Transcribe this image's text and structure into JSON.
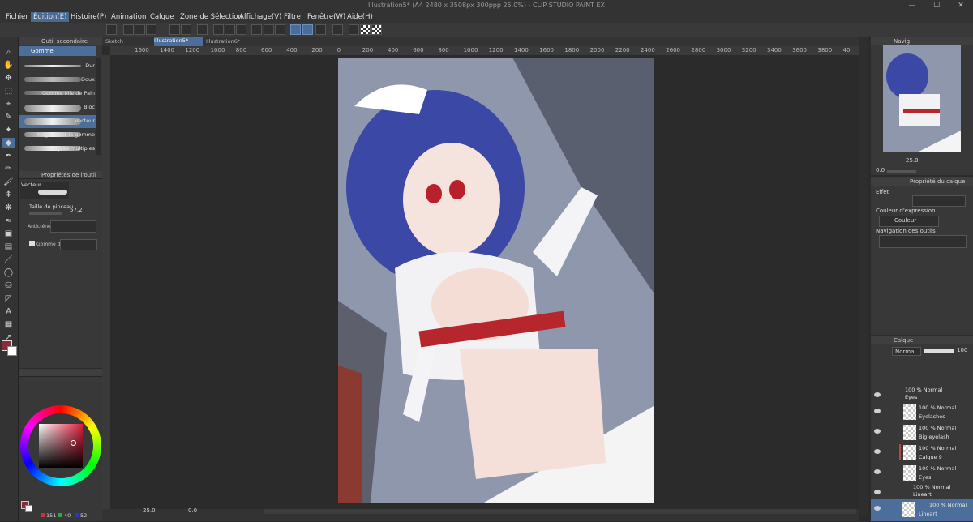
{
  "window": {
    "title": "Illustration5* (A4 2480 x 3508px 300ppp 25.0%) - CLIP STUDIO PAINT EX"
  },
  "menu": [
    "Fichier",
    "Édition(E)",
    "Histoire(P)",
    "Animation",
    "Calque",
    "Zone de Sélection",
    "Affichage(V)",
    "Filtre",
    "Fenêtre(W)",
    "Aide(H)"
  ],
  "tabs": [
    "Sketch",
    "Illustration5*",
    "Illustration6*"
  ],
  "ruler_top": [
    "1600",
    "1400",
    "1200",
    "1000",
    "800",
    "600",
    "400",
    "200",
    "0",
    "200",
    "400",
    "600",
    "800",
    "1000",
    "1200",
    "1400",
    "1600",
    "1800",
    "2000",
    "2200",
    "2400",
    "2600",
    "2800",
    "3000",
    "3200",
    "3400",
    "3600",
    "3800",
    "40"
  ],
  "subtool": {
    "title": "Outil secondaire",
    "group": "Gomme",
    "items": [
      "Dur",
      "Doux",
      "Gomme Mie de Pain",
      "Bloc",
      "Vecteur",
      "Magnétiser la gomme",
      "Calques multiples"
    ],
    "selected_index": 4
  },
  "tool_props": {
    "title": "Propriétés de l'outil",
    "name": "Vecteur",
    "brush_size_label": "Taille de pinceau",
    "brush_size_value": "57.2",
    "antialias_label": "Anticrénel.",
    "erase_label": "Gomme de"
  },
  "color_wheel": {
    "main_color": "#8b2b3a",
    "sub_color": "#ffffff",
    "r": "151",
    "g": "40",
    "b": "52"
  },
  "canvas_footer": {
    "zoom": "25.0",
    "rotation": "0.0"
  },
  "navigator": {
    "title": "Navig",
    "zoom": "25.0",
    "angle": "0.0"
  },
  "layer_props": {
    "title": "Propriété du calque",
    "effect_label": "Effet",
    "expression_color_label": "Couleur d'expression",
    "expression_color_value": "Couleur",
    "tool_nav_label": "Navigation des outils"
  },
  "layers_panel": {
    "title": "Calque",
    "blend_mode": "Normal",
    "opacity": "100",
    "layers": [
      {
        "mode": "100 % Normal",
        "name": "Eyes",
        "folder": true
      },
      {
        "mode": "100 % Normal",
        "name": "Eyelashes",
        "folder": false
      },
      {
        "mode": "100 % Normal",
        "name": "Big eyelash",
        "folder": false
      },
      {
        "mode": "100 % Normal",
        "name": "Calque 9",
        "folder": false
      },
      {
        "mode": "100 % Normal",
        "name": "Eyes",
        "folder": false
      },
      {
        "mode": "100 % Normal",
        "name": "Lineart",
        "folder": true
      },
      {
        "mode": "100 % Normal",
        "name": "Lineart",
        "folder": false
      }
    ]
  },
  "colors": {
    "accent": "#4b6d99",
    "panel": "#383838",
    "background": "#2b2b2b",
    "canvas_bg": "#8f97ad"
  }
}
